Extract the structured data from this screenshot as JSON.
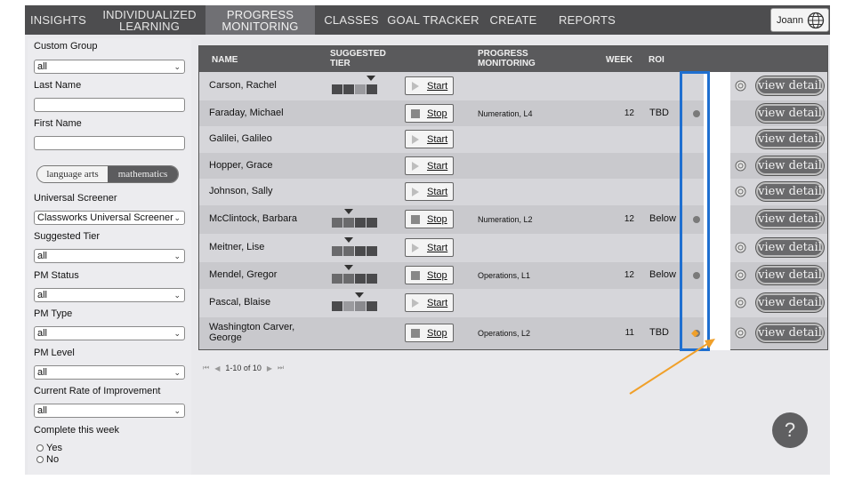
{
  "nav": {
    "items": [
      {
        "label": "INSIGHTS"
      },
      {
        "label_line1": "INDIVIDUALIZED",
        "label_line2": "LEARNING"
      },
      {
        "label_line1": "PROGRESS",
        "label_line2": "MONITORING"
      },
      {
        "label": "CLASSES"
      },
      {
        "label": "GOAL TRACKER"
      },
      {
        "label": "CREATE"
      },
      {
        "label": "REPORTS"
      }
    ],
    "active": "PROGRESS MONITORING",
    "user": "Joann"
  },
  "sidebar": {
    "custom_group_label": "Custom Group",
    "custom_group_value": "all",
    "last_name_label": "Last Name",
    "first_name_label": "First Name",
    "subject_options": [
      "language arts",
      "mathematics"
    ],
    "subject_selected": "mathematics",
    "screener_label": "Universal Screener",
    "screener_value": "Classworks Universal Screener",
    "tier_label": "Suggested Tier",
    "tier_value": "all",
    "pm_status_label": "PM Status",
    "pm_status_value": "all",
    "pm_type_label": "PM Type",
    "pm_type_value": "all",
    "pm_level_label": "PM Level",
    "pm_level_value": "all",
    "rate_label": "Current Rate of Improvement",
    "rate_value": "all",
    "complete_label": "Complete this week",
    "yes_label": "Yes",
    "no_label": "No"
  },
  "table": {
    "headers": {
      "name": "NAME",
      "tier_line1": "SUGGESTED",
      "tier_line2": "TIER",
      "pm_line1": "PROGRESS",
      "pm_line2": "MONITORING",
      "week": "WEEK",
      "roi": "ROI"
    },
    "rows": [
      {
        "name": "Carson, Rachel",
        "tier": 3,
        "button": "Start",
        "pm": "",
        "week": "",
        "roi": "",
        "dot": false,
        "gear": true
      },
      {
        "name": "Faraday, Michael",
        "tier": 0,
        "button": "Stop",
        "pm": "Numeration, L4",
        "week": "12",
        "roi": "TBD",
        "dot": true,
        "gear": false
      },
      {
        "name": "Galilei, Galileo",
        "tier": 0,
        "button": "Start",
        "pm": "",
        "week": "",
        "roi": "",
        "dot": false,
        "gear": false
      },
      {
        "name": "Hopper, Grace",
        "tier": 0,
        "button": "Start",
        "pm": "",
        "week": "",
        "roi": "",
        "dot": false,
        "gear": true
      },
      {
        "name": "Johnson, Sally",
        "tier": 0,
        "button": "Start",
        "pm": "",
        "week": "",
        "roi": "",
        "dot": false,
        "gear": true
      },
      {
        "name": "McClintock, Barbara",
        "tier": 1,
        "button": "Stop",
        "pm": "Numeration, L2",
        "week": "12",
        "roi": "Below",
        "dot": true,
        "gear": false
      },
      {
        "name": "Meitner, Lise",
        "tier": 1,
        "button": "Start",
        "pm": "",
        "week": "",
        "roi": "",
        "dot": false,
        "gear": true
      },
      {
        "name": "Mendel, Gregor",
        "tier": 1,
        "button": "Stop",
        "pm": "Operations, L1",
        "week": "12",
        "roi": "Below",
        "dot": true,
        "gear": true
      },
      {
        "name": "Pascal, Blaise",
        "tier": 2,
        "button": "Start",
        "pm": "",
        "week": "",
        "roi": "",
        "dot": false,
        "gear": true
      },
      {
        "name_line1": "Washington Carver,",
        "name_line2": "George",
        "tier": 0,
        "button": "Stop",
        "pm": "Operations, L2",
        "week": "11",
        "roi": "TBD",
        "dot": true,
        "gear": true,
        "warning": true
      }
    ],
    "view_label": "view detail",
    "pager_text": "1-10 of 10"
  },
  "help_label": "?",
  "colors": {
    "highlight": "#1f6fd0",
    "arrow": "#f0a02a",
    "nav_bg": "#4d4d4f"
  }
}
